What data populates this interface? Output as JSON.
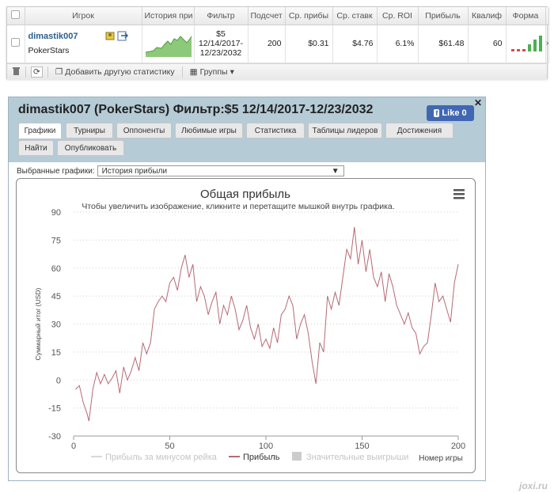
{
  "table": {
    "headers": [
      "Игрок",
      "История при",
      "Фильтр",
      "Подсчет",
      "Ср. прибы",
      "Ср. ставк",
      "Ср. ROI",
      "Прибыль",
      "Квалиф",
      "Форма"
    ],
    "row": {
      "player": "dimastik007",
      "site": "PokerStars",
      "filter_line1": "$5",
      "filter_line2": "12/14/2017-",
      "filter_line3": "12/23/2032",
      "count": "200",
      "avg_profit": "$0.31",
      "avg_stake": "$4.76",
      "avg_roi": "6.1%",
      "profit": "$61.48",
      "qualif": "60"
    },
    "form_bars": [
      {
        "color": "#d24d4d",
        "level": 0.1
      },
      {
        "color": "#d24d4d",
        "level": 0.1
      },
      {
        "color": "#d24d4d",
        "level": 0.1
      },
      {
        "color": "#4caf50",
        "level": 0.45
      },
      {
        "color": "#4caf50",
        "level": 0.75
      },
      {
        "color": "#4caf50",
        "level": 1.0
      }
    ],
    "toolbar": {
      "add_stats": "Добавить другую статистику",
      "groups": "Группы"
    }
  },
  "panel": {
    "title": "dimastik007 (PokerStars) Фильтр:$5 12/14/2017-12/23/2032",
    "like_label": "Like",
    "like_count": "0",
    "tabs": [
      "Графики",
      "Турниры",
      "Оппоненты",
      "Любимые игры",
      "Статистика",
      "Таблицы лидеров",
      "Достижения",
      "Найти",
      "Опубликовать"
    ],
    "selected_label": "Выбранные графики:",
    "selected_value": "История прибыли"
  },
  "chart_data": {
    "type": "line",
    "title": "Общая прибыль",
    "subtitle": "Чтобы увеличить изображение, кликните и перетащите мышкой внутрь графика.",
    "xlabel": "Номер игры",
    "ylabel": "Суммарный итог (USD)",
    "xlim": [
      0,
      200
    ],
    "ylim": [
      -30,
      90
    ],
    "xticks": [
      0,
      50,
      100,
      150,
      200
    ],
    "yticks": [
      -30,
      -15,
      0,
      15,
      30,
      45,
      60,
      75,
      90
    ],
    "grid": true,
    "legend": [
      "Прибыль за минусом рейка",
      "Прибыль",
      "Значительные выигрыши"
    ],
    "series": [
      {
        "name": "Прибыль",
        "color": "#b56a74",
        "x": [
          1,
          3,
          5,
          7,
          8,
          10,
          12,
          14,
          16,
          18,
          20,
          22,
          24,
          26,
          28,
          30,
          32,
          34,
          36,
          38,
          40,
          42,
          44,
          46,
          48,
          50,
          52,
          54,
          56,
          58,
          60,
          62,
          64,
          66,
          68,
          70,
          72,
          74,
          76,
          78,
          80,
          82,
          84,
          86,
          88,
          90,
          92,
          94,
          96,
          98,
          100,
          102,
          104,
          106,
          108,
          110,
          112,
          114,
          116,
          118,
          120,
          122,
          124,
          126,
          128,
          130,
          132,
          134,
          136,
          138,
          140,
          142,
          144,
          146,
          148,
          150,
          152,
          154,
          156,
          158,
          160,
          162,
          164,
          166,
          168,
          170,
          172,
          174,
          176,
          178,
          180,
          182,
          184,
          186,
          188,
          190,
          192,
          194,
          196,
          198,
          200
        ],
        "y": [
          -5,
          -3,
          -12,
          -18,
          -22,
          -5,
          4,
          -2,
          3,
          -2,
          1,
          5,
          -7,
          7,
          0,
          5,
          12,
          5,
          20,
          14,
          20,
          38,
          42,
          45,
          42,
          52,
          55,
          48,
          60,
          67,
          55,
          62,
          42,
          50,
          45,
          35,
          42,
          47,
          30,
          40,
          35,
          45,
          38,
          27,
          32,
          40,
          28,
          22,
          30,
          18,
          22,
          17,
          28,
          20,
          35,
          38,
          45,
          40,
          22,
          30,
          35,
          25,
          10,
          -2,
          20,
          15,
          45,
          38,
          47,
          40,
          55,
          70,
          65,
          82,
          62,
          75,
          58,
          70,
          55,
          50,
          58,
          42,
          57,
          50,
          40,
          35,
          30,
          36,
          28,
          25,
          14,
          18,
          20,
          35,
          52,
          42,
          45,
          38,
          31,
          52,
          62
        ]
      }
    ]
  }
}
